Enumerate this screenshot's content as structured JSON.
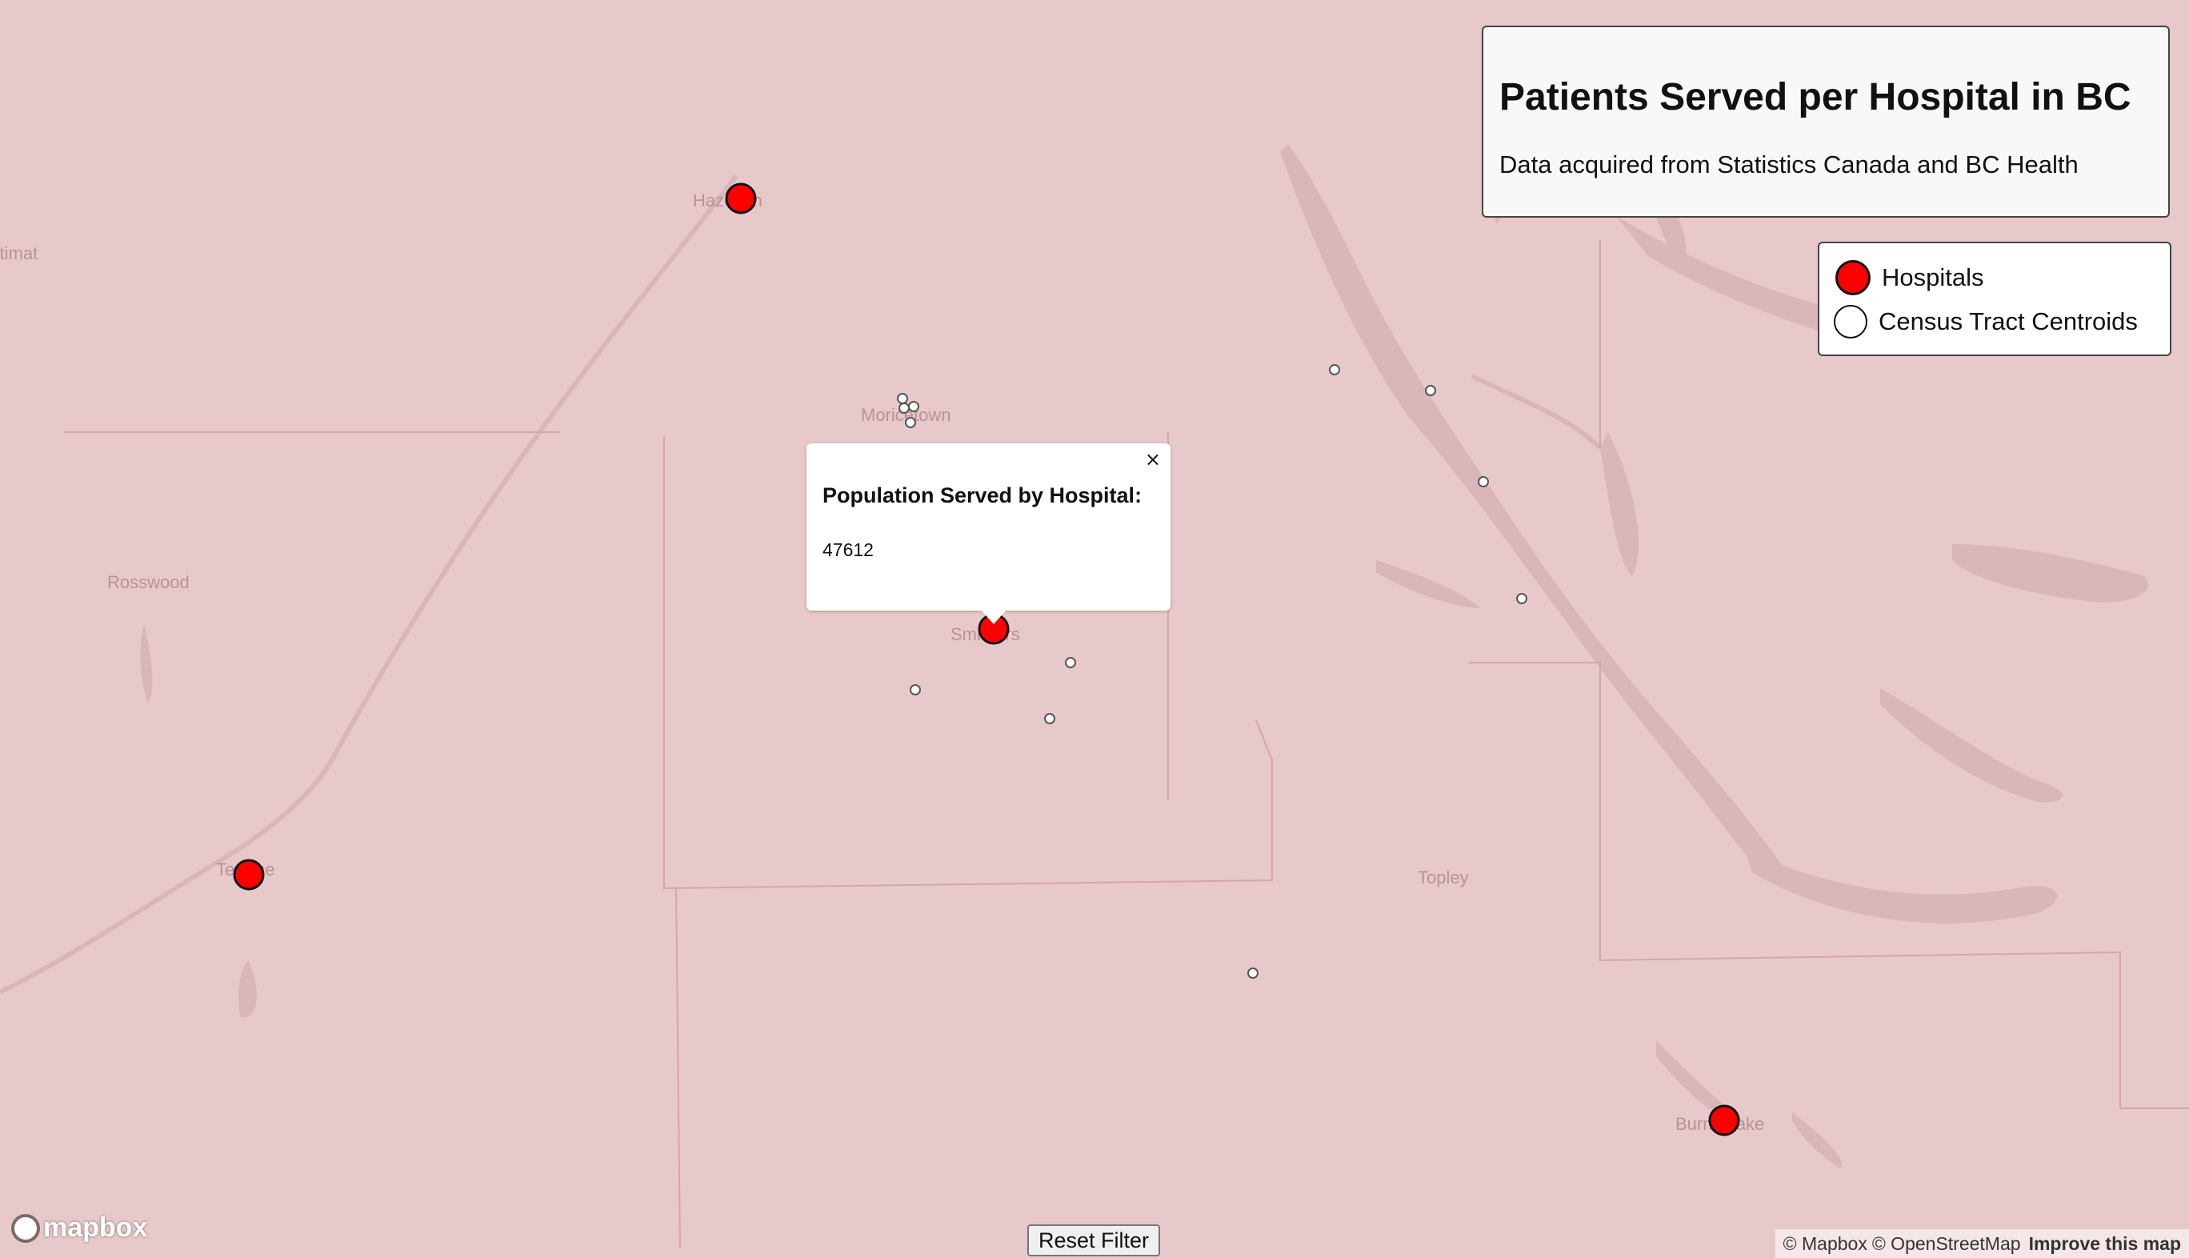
{
  "title": "Patients Served per Hospital in BC",
  "subtitle": "Data acquired from Statistics Canada and BC Health",
  "legend": {
    "items": [
      {
        "label": "Hospitals",
        "color": "#ff0000"
      },
      {
        "label": "Census Tract Centroids",
        "color": "#ffffff"
      }
    ]
  },
  "popup": {
    "heading": "Population Served by Hospital:",
    "value": "47612",
    "close": "×"
  },
  "reset_button": "Reset Filter",
  "places": [
    {
      "name": "Hazelton"
    },
    {
      "name": "Moricetown"
    },
    {
      "name": "Smithers"
    },
    {
      "name": "Rosswood"
    },
    {
      "name": "Terrace"
    },
    {
      "name": "Topley"
    },
    {
      "name": "Burns Lake"
    },
    {
      "name": "Kitimat"
    }
  ],
  "hospitals": [
    {
      "place": "Hazelton"
    },
    {
      "place": "Smithers"
    },
    {
      "place": "Terrace"
    },
    {
      "place": "Burns Lake"
    }
  ],
  "logo": "mapbox",
  "attribution": {
    "mapbox": "© Mapbox",
    "osm": "© OpenStreetMap",
    "improve": "Improve this map"
  },
  "colors": {
    "map_background": "#e8c9cb",
    "water": "#d9b6b8",
    "hospital": "#ff0000"
  }
}
